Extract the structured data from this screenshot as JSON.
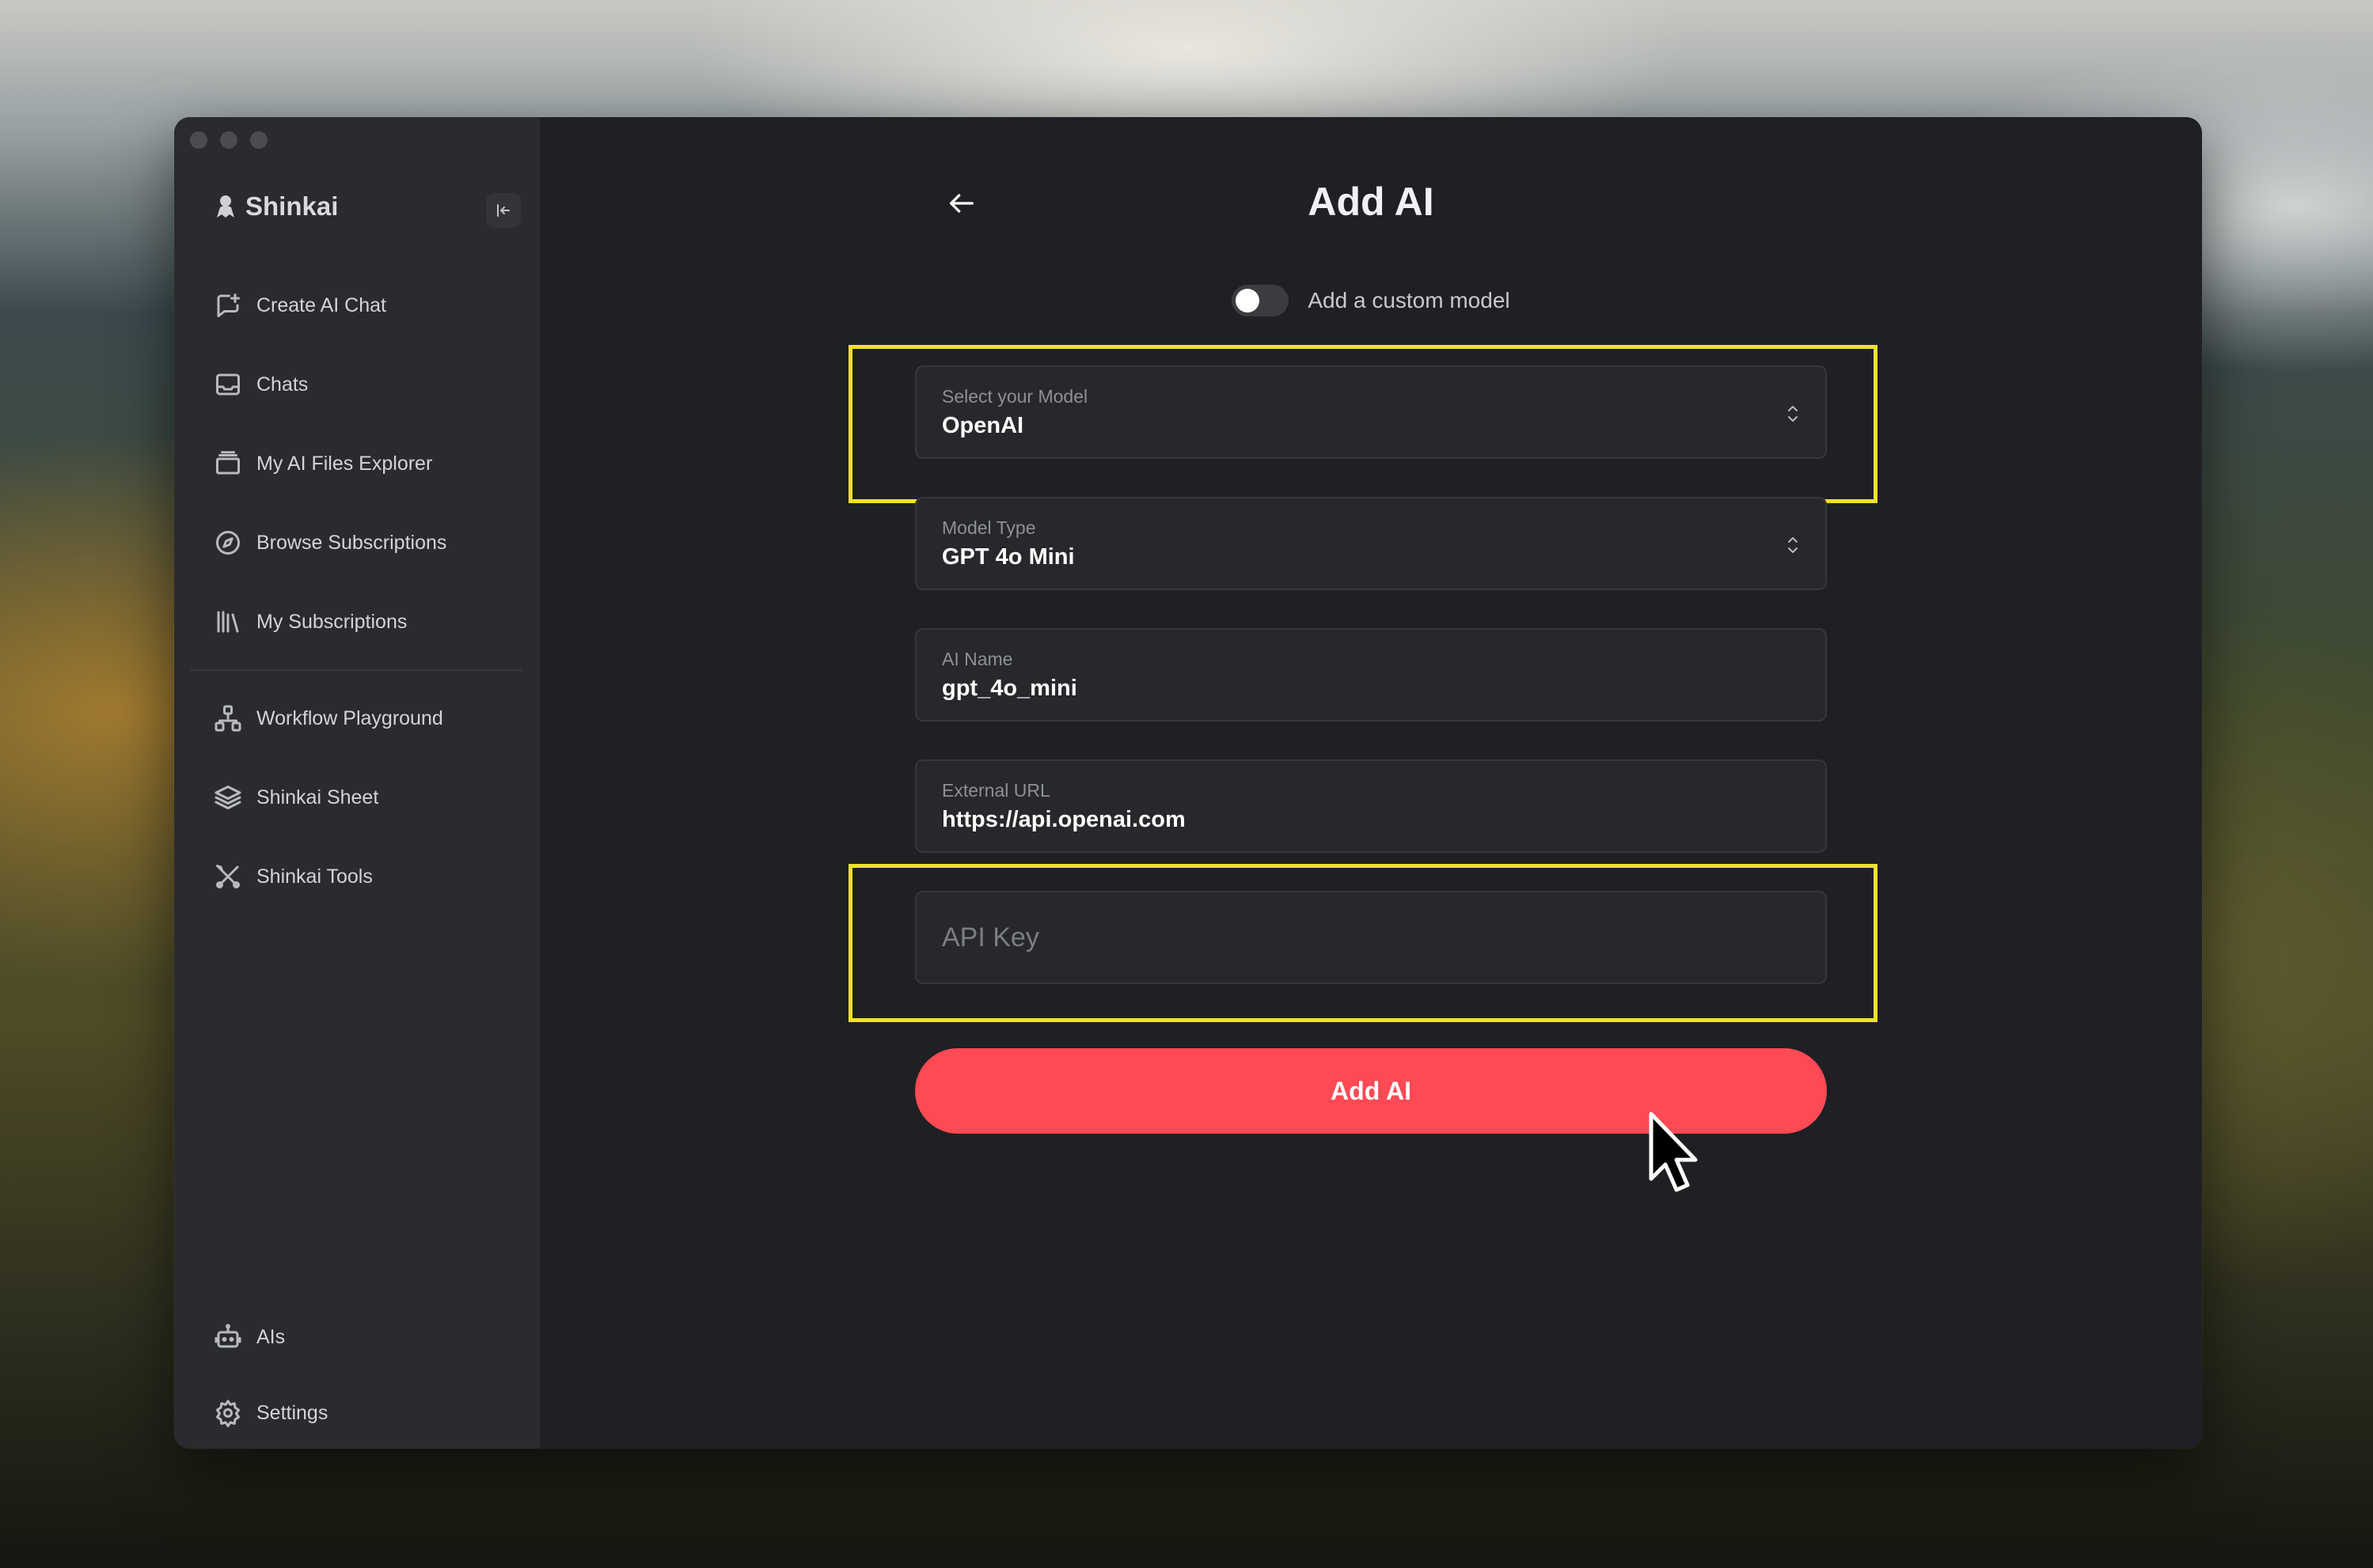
{
  "app": {
    "name": "Shinkai"
  },
  "sidebar": {
    "items": [
      {
        "label": "Create AI Chat",
        "icon": "chat-plus-icon"
      },
      {
        "label": "Chats",
        "icon": "inbox-icon"
      },
      {
        "label": "My AI Files Explorer",
        "icon": "archive-icon"
      },
      {
        "label": "Browse Subscriptions",
        "icon": "compass-icon"
      },
      {
        "label": "My Subscriptions",
        "icon": "library-icon"
      },
      {
        "label": "Workflow Playground",
        "icon": "workflow-icon"
      },
      {
        "label": "Shinkai Sheet",
        "icon": "layers-icon"
      },
      {
        "label": "Shinkai Tools",
        "icon": "tools-icon"
      }
    ],
    "bottom_items": [
      {
        "label": "AIs",
        "icon": "bot-icon"
      },
      {
        "label": "Settings",
        "icon": "gear-icon"
      }
    ]
  },
  "main": {
    "title": "Add AI",
    "custom_model_toggle": {
      "label": "Add a custom model",
      "on": false
    },
    "fields": {
      "model": {
        "label": "Select your Model",
        "value": "OpenAI"
      },
      "model_type": {
        "label": "Model Type",
        "value": "GPT 4o Mini"
      },
      "ai_name": {
        "label": "AI Name",
        "value": "gpt_4o_mini"
      },
      "external_url": {
        "label": "External URL",
        "value": "https://api.openai.com"
      },
      "api_key": {
        "placeholder": "API Key",
        "value": ""
      }
    },
    "submit_label": "Add AI"
  },
  "colors": {
    "accent": "#fe4a55",
    "highlight": "#f0e12c",
    "window_bg": "#1f2023",
    "sidebar_bg": "#2a2b2e"
  }
}
